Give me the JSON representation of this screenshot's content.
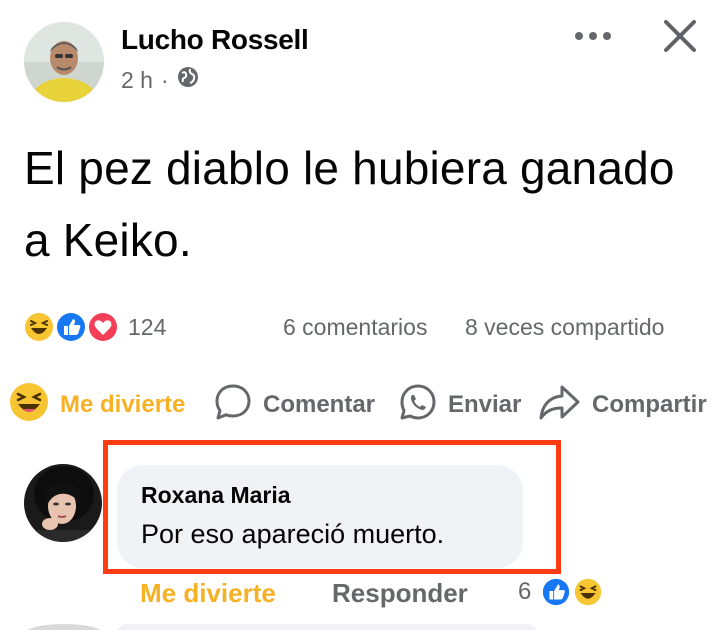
{
  "post": {
    "author": "Lucho Rossell",
    "time": "2 h",
    "separator": "·",
    "privacy_icon": "globe-icon",
    "text": "El pez diablo le hubiera ganado a Keiko."
  },
  "header": {
    "more_icon": "more-dots-icon",
    "close_icon": "close-icon"
  },
  "stats": {
    "reaction_icons": [
      "haha-icon",
      "like-icon",
      "love-icon"
    ],
    "reaction_count": "124",
    "comments": "6 comentarios",
    "shares": "8 veces compartido"
  },
  "actions": {
    "like_label": "Me divierte",
    "comment_label": "Comentar",
    "send_label": "Enviar",
    "share_label": "Compartir"
  },
  "comment": {
    "author": "Roxana Maria",
    "text": "Por eso apareció muerto.",
    "like_label": "Me divierte",
    "reply_label": "Responder",
    "reaction_count": "6",
    "reaction_icons": [
      "like-icon",
      "haha-icon"
    ]
  },
  "colors": {
    "accent_haha": "#f7b125",
    "secondary_text": "#65676b",
    "bubble": "#f0f2f5",
    "highlight": "#ff3b12",
    "like_blue": "#1877f2",
    "love_red": "#f33e58"
  }
}
